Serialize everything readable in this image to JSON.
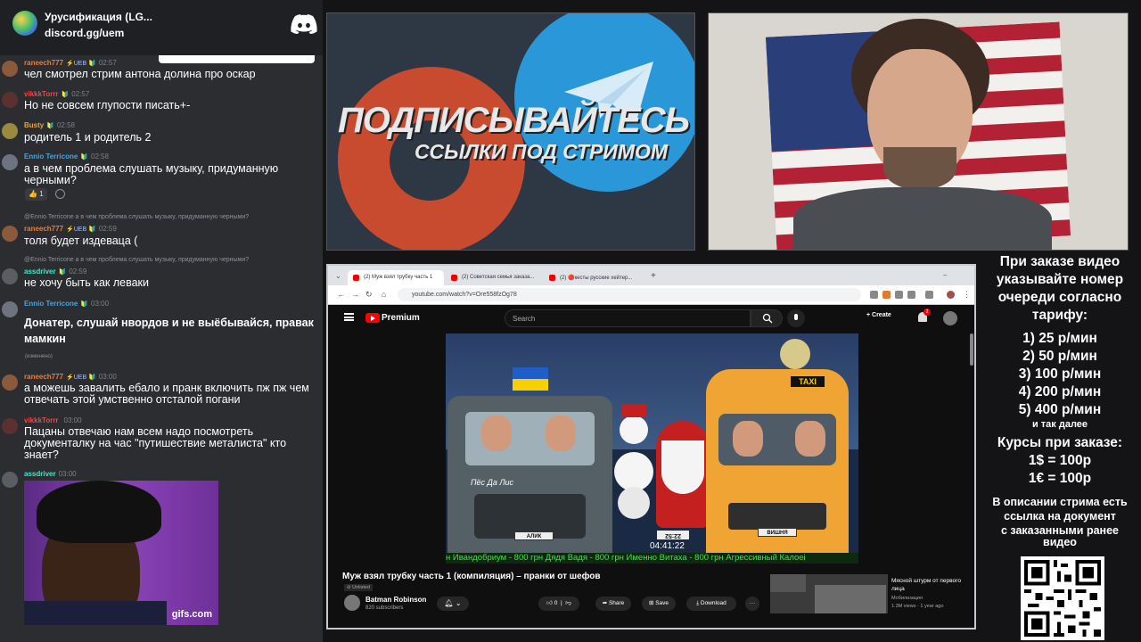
{
  "discord": {
    "title": "Урусификация (LG...",
    "link": "discord.gg/uem"
  },
  "chat": {
    "messages": [
      {
        "user": "raneech777",
        "badges": "⚡UEB 🔰",
        "time": "02:57",
        "text": "чел смотрел стрим антона долина про оскар",
        "color": "#e87c3e"
      },
      {
        "user": "vikkkTorrr",
        "badges": "🔰",
        "time": "02:57",
        "text": "Но не совсем глупости писать+-",
        "color": "#e84a4a"
      },
      {
        "user": "Busty",
        "badges": "🔰",
        "time": "02:58",
        "text": "родитель 1 и родитель 2",
        "color": "#e8a23e"
      },
      {
        "user": "Ennio Terricone",
        "badges": "🔰",
        "time": "02:58",
        "text": "а в чем проблема слушать музыку, придуманную черными?",
        "color": "#3ea7e8"
      },
      {
        "user": "raneech777",
        "badges": "⚡UEB 🔰",
        "time": "02:59",
        "text": "толя будет издеваца (",
        "reply": "@Ennio Terricone  а в чем проблема слушать музыку, придуманную черными?",
        "color": "#e87c3e"
      },
      {
        "user": "assdriver",
        "badges": "🔰",
        "time": "02:59",
        "text": "не хочу быть как леваки",
        "reply": "@Ennio Terricone  а в чем проблема слушать музыку, придуманную черными?",
        "color": "#3ee8c8"
      },
      {
        "user": "Ennio Terricone",
        "badges": "🔰",
        "time": "03:00",
        "text": "Донатер, слушай нвордов и не выёбывайся, правак мамкин",
        "color": "#3ea7e8"
      },
      {
        "user": "raneech777",
        "badges": "⚡UEB 🔰",
        "time": "03:00",
        "text": "а можешь завалить ебало и пранк включить пж пж чем отвечать этой умственно отсталой погани",
        "color": "#e87c3e"
      },
      {
        "user": "vikkkTorrr",
        "badges": "",
        "time": "03:00",
        "text": "Пацаны отвечаю нам всем надо посмотреть документалку на час \"путишествие металиста\" кто знает?",
        "color": "#e84a4a"
      },
      {
        "user": "assdriver",
        "badges": "",
        "time": "03:00",
        "text": "",
        "color": "#3ee8c8"
      }
    ],
    "reaction": "1",
    "edited_note": "(изменено)",
    "gif_label": "gifs.com"
  },
  "promo": {
    "title": "ПОДПИСЫВАЙТЕСЬ",
    "subtitle": "ССЫЛКИ ПОД СТРИМОМ"
  },
  "browser": {
    "tabs": [
      "(2) Муж взял трубку часть 1",
      "(2) Советская семья заказа...",
      "(2) 🔴кесты русские хейтер..."
    ],
    "new_tab": "+",
    "url": "youtube.com/watch?v=Ore558fzOg78"
  },
  "youtube": {
    "brand": "Premium",
    "search_placeholder": "Search",
    "create_label": "+ Create",
    "notif_count": "2",
    "video_title": "Муж взял трубку часть 1 (компиляция) – пранки от шефов",
    "unlisted": "⊘ Unlisted",
    "channel": "Batman Robinson",
    "subs": "820 subscribers",
    "likes": "0",
    "share_label": "Share",
    "save_label": "Save",
    "download_label": "Download",
    "more_label": "···",
    "rec_title": "Мясной штурм от первого лица",
    "rec_channel": "Мобилизация",
    "rec_meta": "1.3M views · 1 year ago",
    "thumb": {
      "dog_sign": "Пёс Да Лис",
      "taxi": "TAXI",
      "plate_left": "АЛИК",
      "plate_right": "ВИШНЯ",
      "counter": "22:52",
      "timer": "04:41:22",
      "marquee": "н Ивандобриум - 800 грн   Дядя Вадя - 800 грн   Именно Витаха - 800 грн   Агрессивный Калоеі"
    }
  },
  "pricing": {
    "intro": [
      "При заказе видео",
      "указывайте номер",
      "очереди согласно",
      "тарифу:"
    ],
    "tiers": [
      "1) 25 р/мин",
      "2) 50 р/мин",
      "3) 100 р/мин",
      "4) 200 р/мин",
      "5) 400 р/мин"
    ],
    "etc": "и так далее",
    "rates_title": "Курсы при заказе:",
    "rates": [
      "1$ = 100р",
      "1€ = 100р"
    ],
    "doc_note": [
      "В описании стрима есть",
      "ссылка на документ",
      "с заказанными ранее",
      "видео"
    ]
  },
  "colors": {
    "chat_bg": "#2b2d31",
    "discord_bar": "#1f2024",
    "youtube_red": "#ff0000",
    "marquee_green": "#34e83e"
  }
}
